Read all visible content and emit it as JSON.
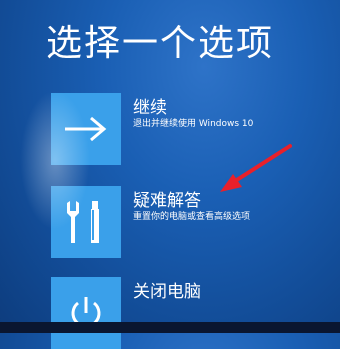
{
  "screen": {
    "title": "选择一个选项"
  },
  "options": [
    {
      "label": "继续",
      "description": "退出并继续使用 Windows 10",
      "icon": "arrow-right-icon"
    },
    {
      "label": "疑难解答",
      "description": "重置你的电脑或查看高级选项",
      "icon": "tools-icon"
    },
    {
      "label": "关闭电脑",
      "description": "",
      "icon": "power-icon"
    }
  ],
  "colors": {
    "background": "#1a5fb4",
    "tile": "#3aa0ea",
    "annotation_arrow": "#e8202a"
  }
}
